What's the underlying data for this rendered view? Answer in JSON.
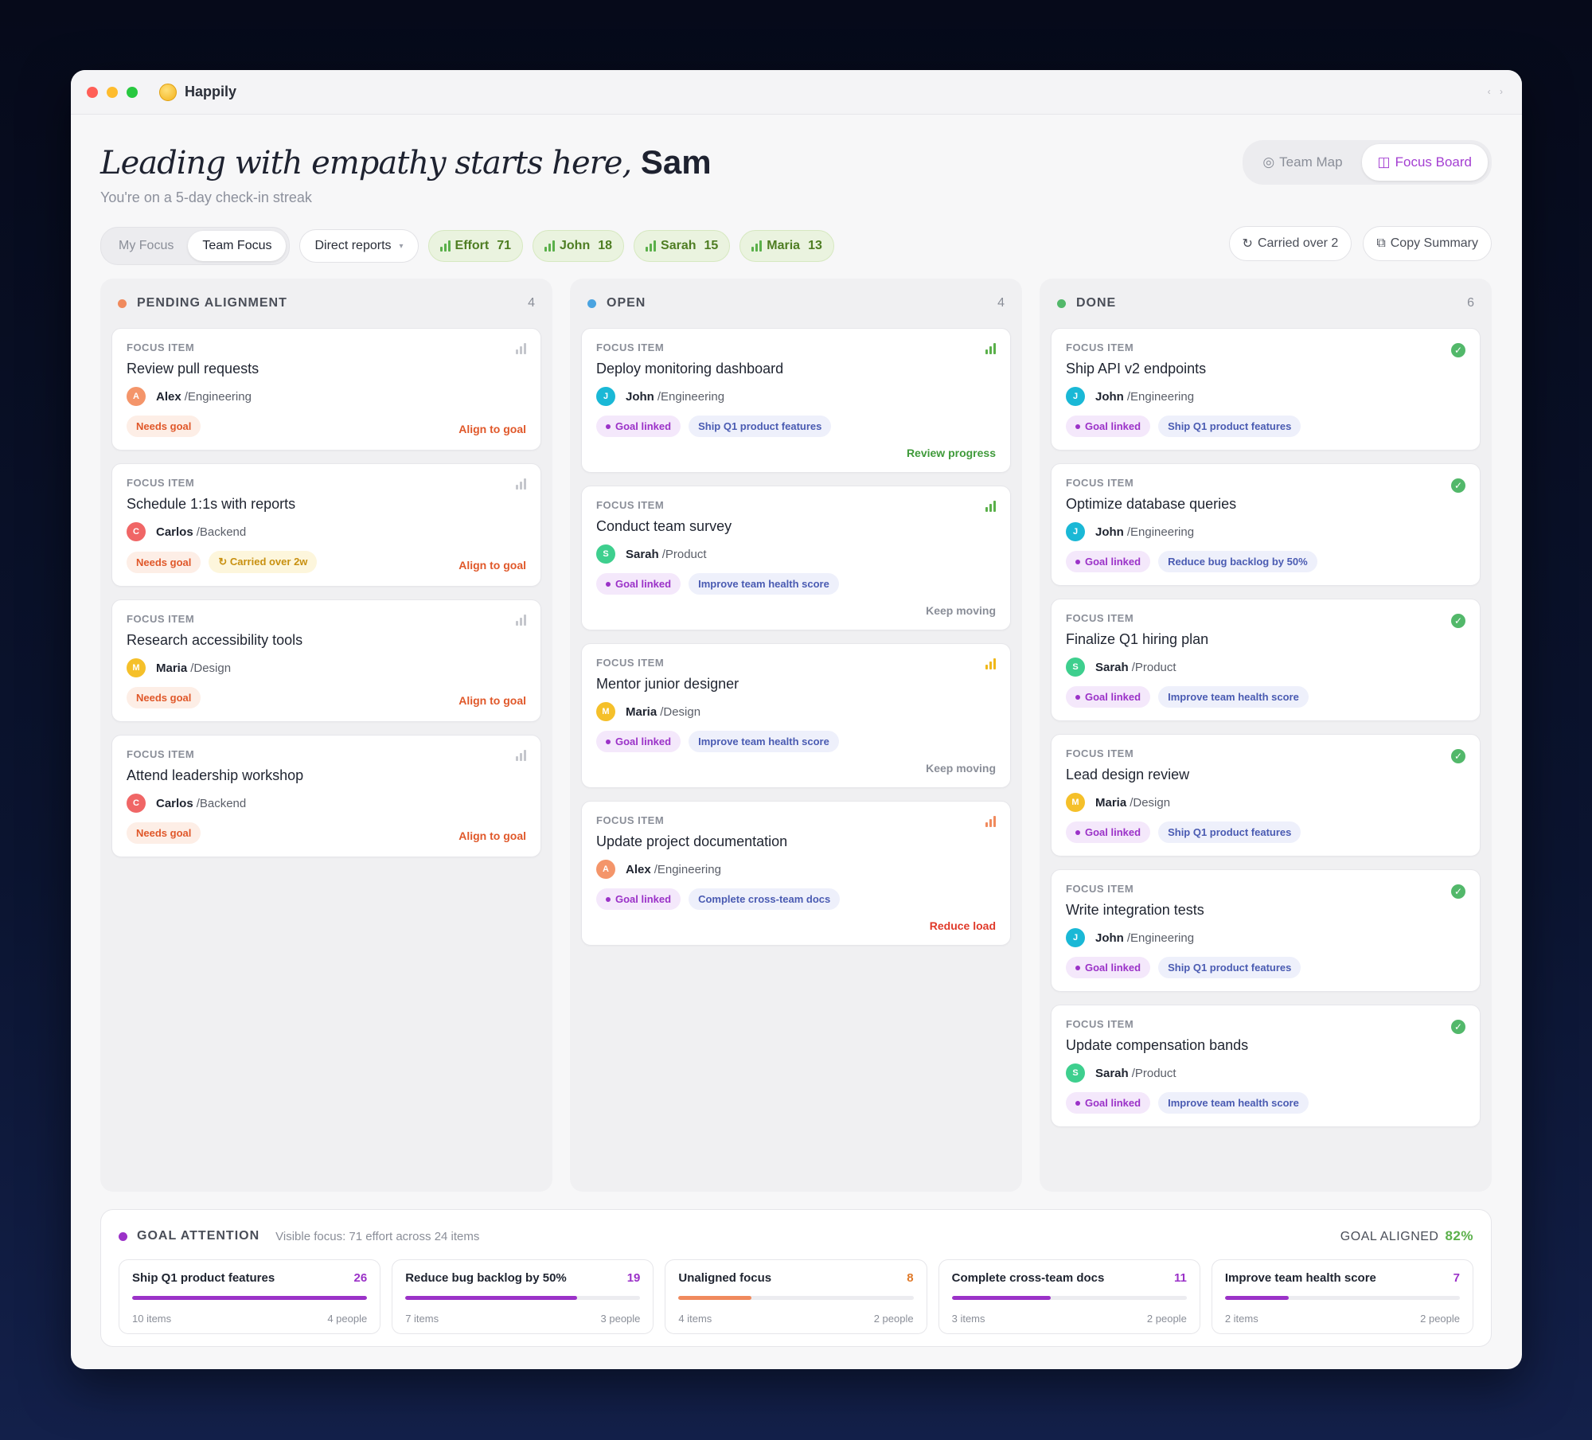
{
  "app": {
    "name": "Happily"
  },
  "hero": {
    "title": "Leading with empathy starts here,",
    "name": "Sam",
    "streak": "You're on a 5-day check-in streak"
  },
  "view_toggle": [
    {
      "label": "Team Map",
      "icon": "target-icon",
      "active": false
    },
    {
      "label": "Focus Board",
      "icon": "board-icon",
      "active": true
    }
  ],
  "toolbar": {
    "scope": [
      {
        "label": "My Focus",
        "active": false
      },
      {
        "label": "Team Focus",
        "active": true
      }
    ],
    "filter": "Direct reports",
    "effort": [
      {
        "label": "Effort",
        "value": "71"
      },
      {
        "label": "John",
        "value": "18"
      },
      {
        "label": "Sarah",
        "value": "15"
      },
      {
        "label": "Maria",
        "value": "13"
      }
    ],
    "carried": "Carried over 2",
    "copy": "Copy Summary"
  },
  "columns": [
    {
      "title": "PENDING ALIGNMENT",
      "count": "4",
      "color": "#f08a5d",
      "cards": [
        {
          "label": "FOCUS ITEM",
          "title": "Review pull requests",
          "initial": "A",
          "avatar": "#f4956a",
          "name": "Alex",
          "team": "Engineering",
          "tags": [
            {
              "type": "needs",
              "text": "Needs goal"
            }
          ],
          "action": "Align to goal",
          "action_color": "#e0582a",
          "signal": "gray"
        },
        {
          "label": "FOCUS ITEM",
          "title": "Schedule 1:1s with reports",
          "initial": "C",
          "avatar": "#f06666",
          "name": "Carlos",
          "team": "Backend",
          "tags": [
            {
              "type": "needs",
              "text": "Needs goal"
            },
            {
              "type": "carried",
              "text": "↻ Carried over 2w"
            }
          ],
          "action": "Align to goal",
          "action_color": "#e0582a",
          "signal": "gray"
        },
        {
          "label": "FOCUS ITEM",
          "title": "Research accessibility tools",
          "initial": "M",
          "avatar": "#f5c02a",
          "name": "Maria",
          "team": "Design",
          "tags": [
            {
              "type": "needs",
              "text": "Needs goal"
            }
          ],
          "action": "Align to goal",
          "action_color": "#e0582a",
          "signal": "gray"
        },
        {
          "label": "FOCUS ITEM",
          "title": "Attend leadership workshop",
          "initial": "C",
          "avatar": "#f06666",
          "name": "Carlos",
          "team": "Backend",
          "tags": [
            {
              "type": "needs",
              "text": "Needs goal"
            }
          ],
          "action": "Align to goal",
          "action_color": "#e0582a",
          "signal": "gray"
        }
      ]
    },
    {
      "title": "OPEN",
      "count": "4",
      "color": "#4aa3e0",
      "cards": [
        {
          "label": "FOCUS ITEM",
          "title": "Deploy monitoring dashboard",
          "initial": "J",
          "avatar": "#1ab8d6",
          "name": "John",
          "team": "Engineering",
          "tags": [
            {
              "type": "linked",
              "text": "Goal linked"
            },
            {
              "type": "goal",
              "text": "Ship Q1 product features"
            }
          ],
          "action": "Review progress",
          "action_color": "#3f9a3a",
          "signal": "green"
        },
        {
          "label": "FOCUS ITEM",
          "title": "Conduct team survey",
          "initial": "S",
          "avatar": "#3ecf8e",
          "name": "Sarah",
          "team": "Product",
          "tags": [
            {
              "type": "linked",
              "text": "Goal linked"
            },
            {
              "type": "goal",
              "text": "Improve team health score"
            }
          ],
          "action": "Keep moving",
          "action_color": "#8a8e98",
          "signal": "green"
        },
        {
          "label": "FOCUS ITEM",
          "title": "Mentor junior designer",
          "initial": "M",
          "avatar": "#f5c02a",
          "name": "Maria",
          "team": "Design",
          "tags": [
            {
              "type": "linked",
              "text": "Goal linked"
            },
            {
              "type": "goal",
              "text": "Improve team health score"
            }
          ],
          "action": "Keep moving",
          "action_color": "#8a8e98",
          "signal": "yellow"
        },
        {
          "label": "FOCUS ITEM",
          "title": "Update project documentation",
          "initial": "A",
          "avatar": "#f4956a",
          "name": "Alex",
          "team": "Engineering",
          "tags": [
            {
              "type": "linked",
              "text": "Goal linked"
            },
            {
              "type": "goal",
              "text": "Complete cross-team docs"
            }
          ],
          "action": "Reduce load",
          "action_color": "#e03a2a",
          "signal": "orange"
        }
      ]
    },
    {
      "title": "DONE",
      "count": "6",
      "color": "#52b86a",
      "cards": [
        {
          "label": "FOCUS ITEM",
          "title": "Ship API v2 endpoints",
          "initial": "J",
          "avatar": "#1ab8d6",
          "name": "John",
          "team": "Engineering",
          "tags": [
            {
              "type": "linked",
              "text": "Goal linked"
            },
            {
              "type": "goal",
              "text": "Ship Q1 product features"
            }
          ],
          "action": "",
          "signal": "check"
        },
        {
          "label": "FOCUS ITEM",
          "title": "Optimize database queries",
          "initial": "J",
          "avatar": "#1ab8d6",
          "name": "John",
          "team": "Engineering",
          "tags": [
            {
              "type": "linked",
              "text": "Goal linked"
            },
            {
              "type": "goal",
              "text": "Reduce bug backlog by 50%"
            }
          ],
          "action": "",
          "signal": "check"
        },
        {
          "label": "FOCUS ITEM",
          "title": "Finalize Q1 hiring plan",
          "initial": "S",
          "avatar": "#3ecf8e",
          "name": "Sarah",
          "team": "Product",
          "tags": [
            {
              "type": "linked",
              "text": "Goal linked"
            },
            {
              "type": "goal",
              "text": "Improve team health score"
            }
          ],
          "action": "",
          "signal": "check"
        },
        {
          "label": "FOCUS ITEM",
          "title": "Lead design review",
          "initial": "M",
          "avatar": "#f5c02a",
          "name": "Maria",
          "team": "Design",
          "tags": [
            {
              "type": "linked",
              "text": "Goal linked"
            },
            {
              "type": "goal",
              "text": "Ship Q1 product features"
            }
          ],
          "action": "",
          "signal": "check"
        },
        {
          "label": "FOCUS ITEM",
          "title": "Write integration tests",
          "initial": "J",
          "avatar": "#1ab8d6",
          "name": "John",
          "team": "Engineering",
          "tags": [
            {
              "type": "linked",
              "text": "Goal linked"
            },
            {
              "type": "goal",
              "text": "Ship Q1 product features"
            }
          ],
          "action": "",
          "signal": "check"
        },
        {
          "label": "FOCUS ITEM",
          "title": "Update compensation bands",
          "initial": "S",
          "avatar": "#3ecf8e",
          "name": "Sarah",
          "team": "Product",
          "tags": [
            {
              "type": "linked",
              "text": "Goal linked"
            },
            {
              "type": "goal",
              "text": "Improve team health score"
            }
          ],
          "action": "",
          "signal": "check"
        }
      ]
    }
  ],
  "goal_attention": {
    "title": "GOAL ATTENTION",
    "subtitle": "Visible focus: 71 effort across 24 items",
    "aligned_label": "GOAL ALIGNED",
    "aligned_value": "82%",
    "goals": [
      {
        "name": "Ship Q1 product features",
        "value": "26",
        "progress": 1.0,
        "items": "10 items",
        "people": "4 people",
        "color": "#9b32c8",
        "value_color": "#9b32c8"
      },
      {
        "name": "Reduce bug backlog by 50%",
        "value": "19",
        "progress": 0.73,
        "items": "7 items",
        "people": "3 people",
        "color": "#9b32c8",
        "value_color": "#9b32c8"
      },
      {
        "name": "Unaligned focus",
        "value": "8",
        "progress": 0.31,
        "items": "4 items",
        "people": "2 people",
        "color": "#f08a5d",
        "value_color": "#e07a2a"
      },
      {
        "name": "Complete cross-team docs",
        "value": "11",
        "progress": 0.42,
        "items": "3 items",
        "people": "2 people",
        "color": "#9b32c8",
        "value_color": "#9b32c8"
      },
      {
        "name": "Improve team health score",
        "value": "7",
        "progress": 0.27,
        "items": "2 items",
        "people": "2 people",
        "color": "#9b32c8",
        "value_color": "#9b32c8"
      }
    ]
  }
}
